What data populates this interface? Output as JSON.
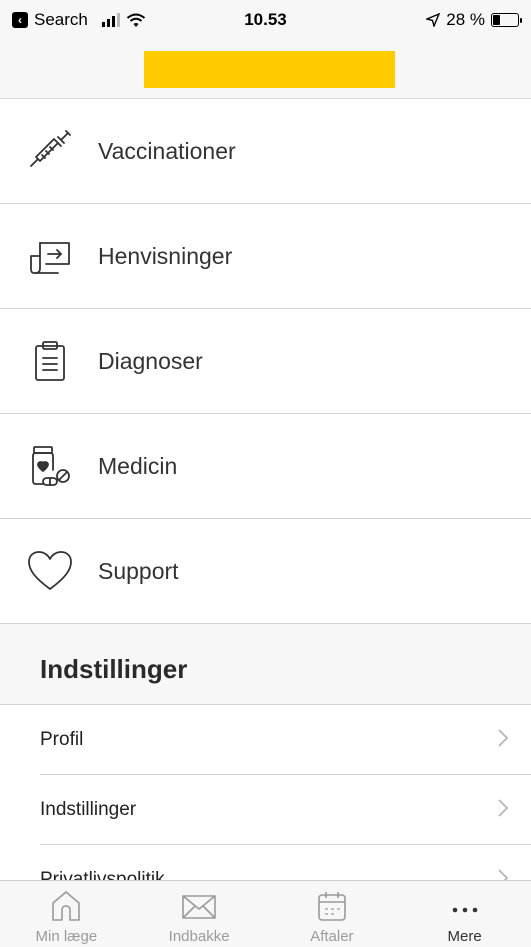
{
  "status_bar": {
    "back_label": "Search",
    "time": "10.53",
    "battery": "28 %",
    "battery_level": 0.28
  },
  "header": {
    "brand_color": "#ffcc00"
  },
  "menu": {
    "items": [
      {
        "label": "Vaccinationer",
        "icon": "syringe-icon"
      },
      {
        "label": "Henvisninger",
        "icon": "referral-icon"
      },
      {
        "label": "Diagnoser",
        "icon": "clipboard-icon"
      },
      {
        "label": "Medicin",
        "icon": "medicine-icon"
      },
      {
        "label": "Support",
        "icon": "heart-icon"
      }
    ]
  },
  "settings_section": {
    "title": "Indstillinger",
    "rows": [
      {
        "label": "Profil"
      },
      {
        "label": "Indstillinger"
      },
      {
        "label": "Privatlivspolitik"
      }
    ]
  },
  "tabbar": {
    "tabs": [
      {
        "label": "Min læge",
        "icon": "home-icon"
      },
      {
        "label": "Indbakke",
        "icon": "mail-icon"
      },
      {
        "label": "Aftaler",
        "icon": "calendar-icon"
      },
      {
        "label": "Mere",
        "icon": "more-icon",
        "active": true
      }
    ]
  }
}
